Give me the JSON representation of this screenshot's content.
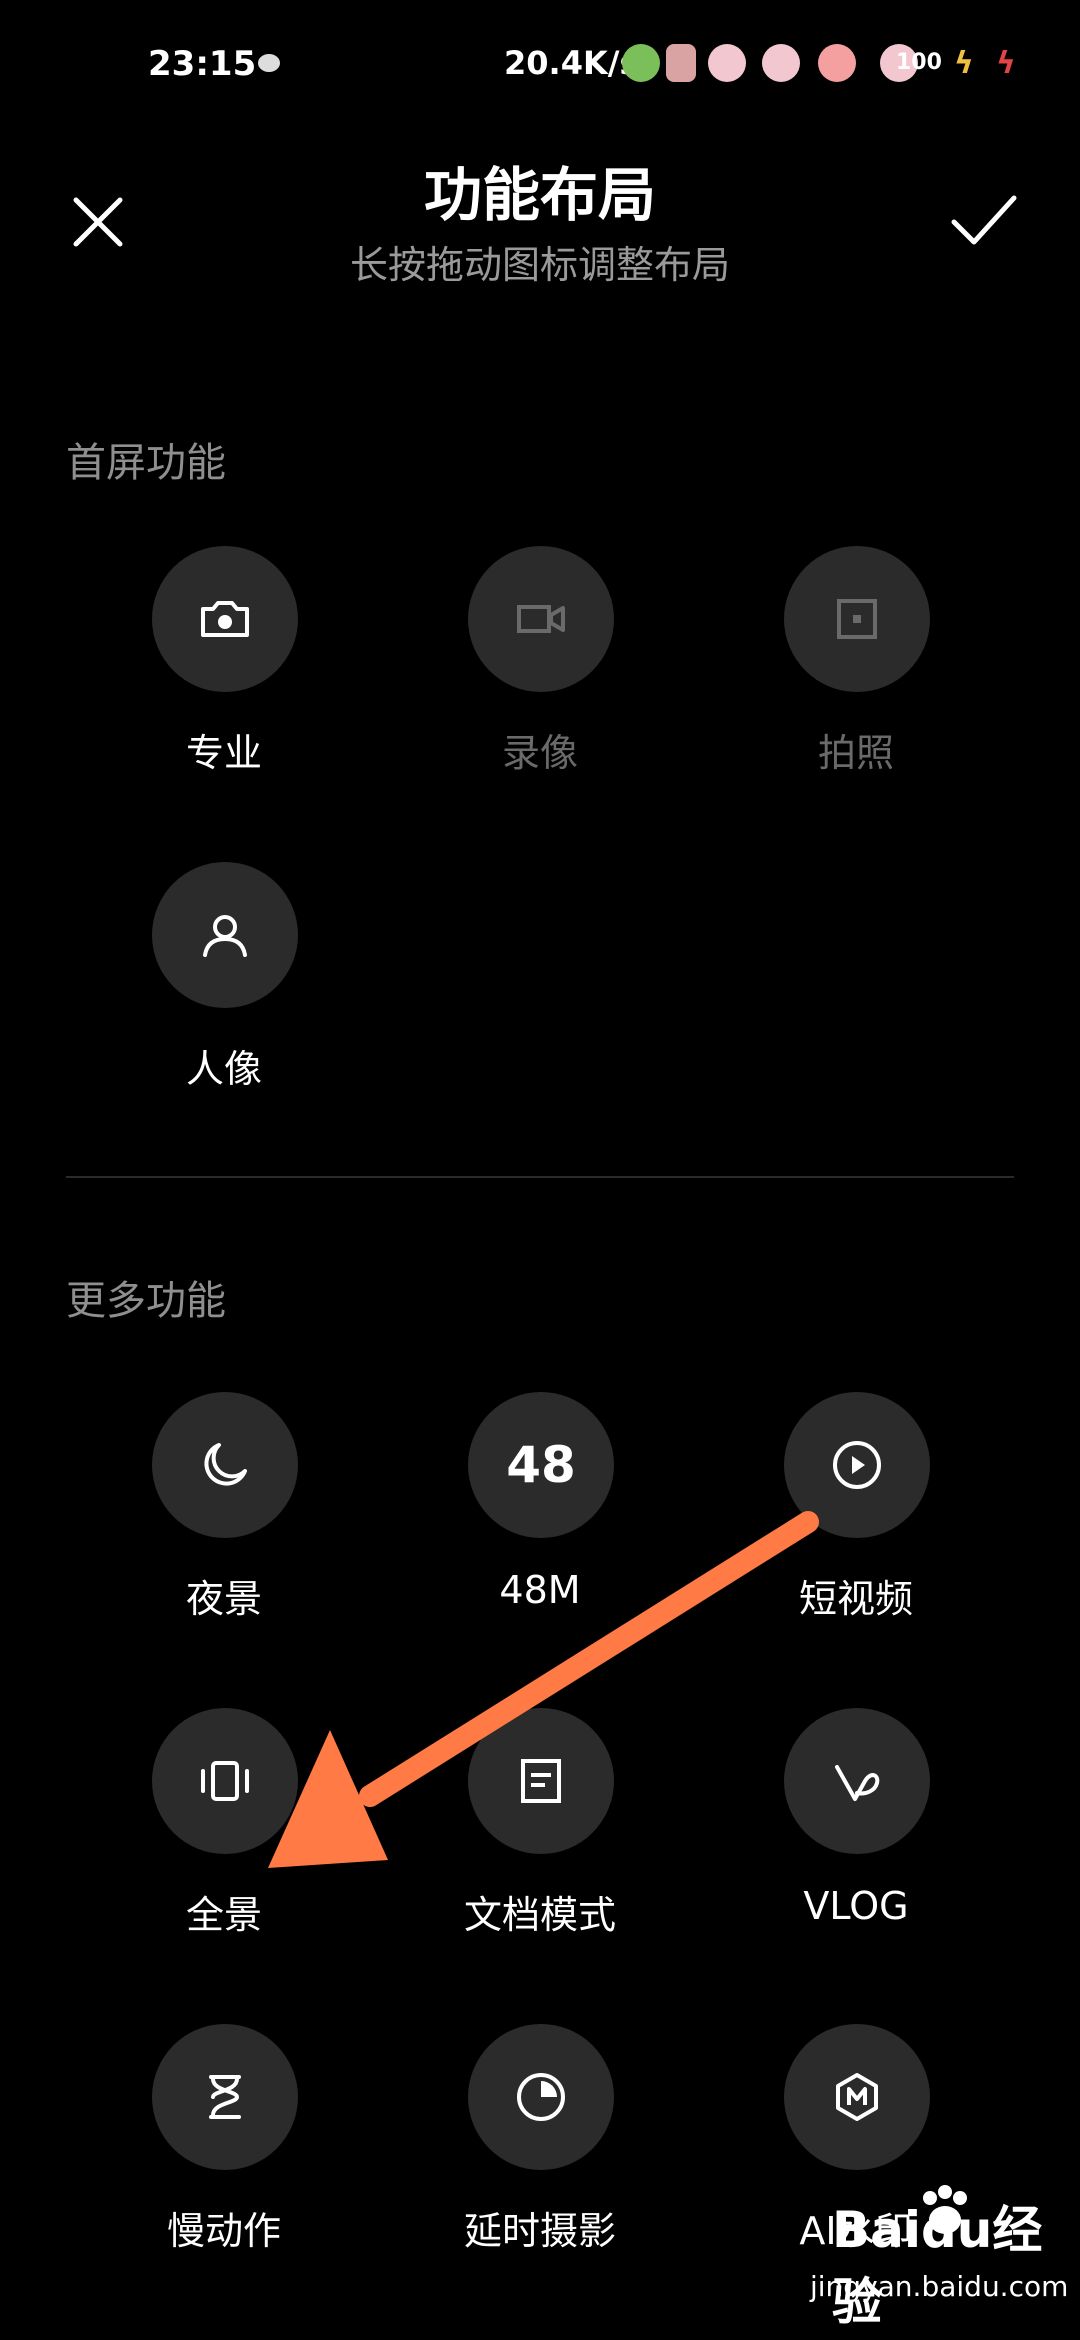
{
  "status_bar": {
    "time": "23:15",
    "speed": "20.4K/s",
    "battery": "100"
  },
  "header": {
    "title": "功能布局",
    "subtitle": "长按拖动图标调整布局",
    "close_icon": "close-icon",
    "confirm_icon": "check-icon"
  },
  "sections": {
    "home": {
      "label": "首屏功能",
      "items": [
        {
          "label": "专业",
          "icon": "camera-icon",
          "dimmed": false
        },
        {
          "label": "录像",
          "icon": "video-icon",
          "dimmed": true
        },
        {
          "label": "拍照",
          "icon": "photo-icon",
          "dimmed": true
        },
        {
          "label": "人像",
          "icon": "person-icon",
          "dimmed": false
        }
      ]
    },
    "more": {
      "label": "更多功能",
      "items": [
        {
          "label": "夜景",
          "icon": "moon-icon"
        },
        {
          "label": "48M",
          "icon": "48-icon",
          "glyph": "48"
        },
        {
          "label": "短视频",
          "icon": "play-icon"
        },
        {
          "label": "全景",
          "icon": "panorama-icon"
        },
        {
          "label": "文档模式",
          "icon": "document-icon"
        },
        {
          "label": "VLOG",
          "icon": "vlog-icon"
        },
        {
          "label": "慢动作",
          "icon": "hourglass-icon"
        },
        {
          "label": "延时摄影",
          "icon": "timelapse-icon"
        },
        {
          "label": "AI水印",
          "icon": "watermark-icon"
        }
      ]
    }
  },
  "annotation": {
    "color": "#ff7a45"
  },
  "watermark": {
    "logo": "Baidu经验",
    "url": "jingyan.baidu.com"
  },
  "colors": {
    "background": "#000000",
    "circle": "#2b2b2b",
    "muted": "#8f8f8f"
  }
}
